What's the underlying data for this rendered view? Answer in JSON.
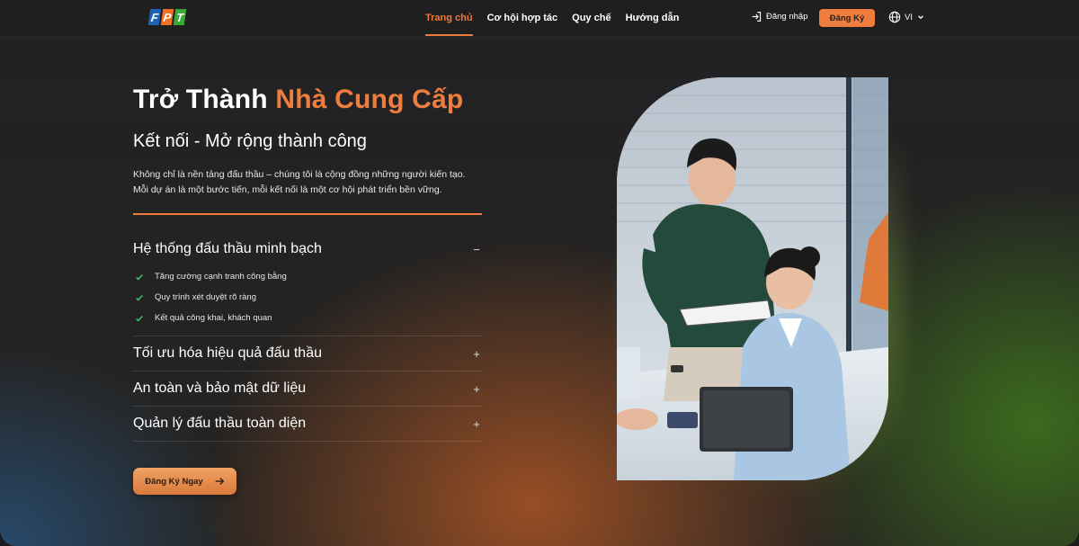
{
  "header": {
    "logo_letters": [
      "F",
      "P",
      "T"
    ],
    "logo_colors": [
      "#1f62b5",
      "#f36f21",
      "#3aa935"
    ],
    "nav": [
      {
        "label": "Trang chủ",
        "active": true
      },
      {
        "label": "Cơ hội hợp tác",
        "active": false
      },
      {
        "label": "Quy chế",
        "active": false
      },
      {
        "label": "Hướng dẫn",
        "active": false
      }
    ],
    "login_label": "Đăng nhập",
    "register_label": "Đăng Ký",
    "language": "VI"
  },
  "hero": {
    "title_prefix": "Trở Thành",
    "title_accent": "Nhà Cung Cấp",
    "subtitle": "Kết nối - Mở rộng thành công",
    "description_line1": "Không chỉ là nền tảng đấu thầu – chúng tôi là cộng đồng những người kiến tạo.",
    "description_line2": "Mỗi dự án là một bước tiến, mỗi kết nối là một cơ hội phát triển bền vững.",
    "accordion": [
      {
        "title": "Hệ thống đấu thầu minh bạch",
        "toggle": "−",
        "expanded": true,
        "items": [
          "Tăng cường cạnh tranh công bằng",
          "Quy trình xét duyệt rõ ràng",
          "Kết quả công khai, khách quan"
        ]
      },
      {
        "title": "Tối ưu hóa hiệu quả đấu thầu",
        "toggle": "+",
        "expanded": false
      },
      {
        "title": "An toàn và bảo mật dữ liệu",
        "toggle": "+",
        "expanded": false
      },
      {
        "title": "Quản lý đấu thầu toàn diện",
        "toggle": "+",
        "expanded": false
      }
    ],
    "cta_label": "Đăng Ký Ngay"
  },
  "colors": {
    "accent": "#ef7e3e",
    "check": "#3fc06b",
    "background": "#222224"
  }
}
